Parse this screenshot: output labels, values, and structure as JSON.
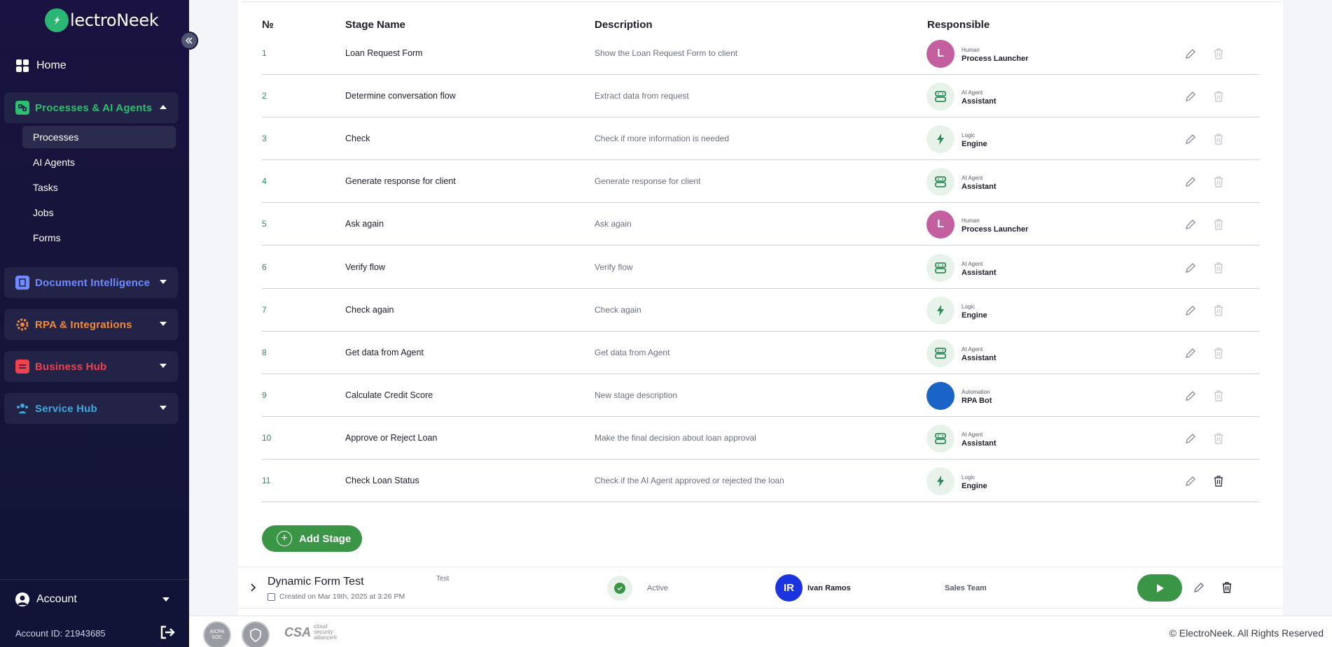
{
  "sidebar": {
    "logo_text": "lectroNeek",
    "home_label": "Home",
    "groups": [
      {
        "label": "Processes & AI Agents",
        "color": "#2bbf6f",
        "expanded": true
      },
      {
        "label": "Document Intelligence",
        "color": "#6e8cff",
        "expanded": false
      },
      {
        "label": "RPA & Integrations",
        "color": "#f08a3c",
        "expanded": false
      },
      {
        "label": "Business Hub",
        "color": "#f0414f",
        "expanded": false
      },
      {
        "label": "Service Hub",
        "color": "#40a8dc",
        "expanded": false
      }
    ],
    "subitems": [
      "Processes",
      "AI Agents",
      "Tasks",
      "Jobs",
      "Forms"
    ],
    "active_subitem": "Processes",
    "account_label": "Account",
    "account_id": "Account ID: 21943685"
  },
  "table": {
    "headers": {
      "num": "№",
      "name": "Stage Name",
      "desc": "Description",
      "resp": "Responsible"
    },
    "rows": [
      {
        "num": "1",
        "name": "Loan Request Form",
        "desc": "Show the Loan Request Form to client",
        "kind": "human",
        "avatar": "L",
        "rtype": "Human",
        "rname": "Process Launcher"
      },
      {
        "num": "2",
        "name": "Determine conversation flow",
        "desc": "Extract data from request",
        "kind": "ai",
        "avatar": "",
        "rtype": "AI Agent",
        "rname": "Assistant"
      },
      {
        "num": "3",
        "name": "Check",
        "desc": "Check if more information is needed",
        "kind": "logic",
        "avatar": "",
        "rtype": "Logic",
        "rname": "Engine"
      },
      {
        "num": "4",
        "name": "Generate response for client",
        "desc": "Generate response for client",
        "kind": "ai",
        "avatar": "",
        "rtype": "AI Agent",
        "rname": "Assistant"
      },
      {
        "num": "5",
        "name": "Ask again",
        "desc": "Ask again",
        "kind": "human",
        "avatar": "L",
        "rtype": "Human",
        "rname": "Process Launcher"
      },
      {
        "num": "6",
        "name": "Verify flow",
        "desc": "Verify flow",
        "kind": "ai",
        "avatar": "",
        "rtype": "AI Agent",
        "rname": "Assistant"
      },
      {
        "num": "7",
        "name": "Check again",
        "desc": "Check again",
        "kind": "logic",
        "avatar": "",
        "rtype": "Logic",
        "rname": "Engine"
      },
      {
        "num": "8",
        "name": "Get data from Agent",
        "desc": "Get data from Agent",
        "kind": "ai",
        "avatar": "",
        "rtype": "AI Agent",
        "rname": "Assistant"
      },
      {
        "num": "9",
        "name": "Calculate Credit Score",
        "desc": "New stage description",
        "kind": "auto",
        "avatar": "",
        "rtype": "Automation",
        "rname": "RPA Bot"
      },
      {
        "num": "10",
        "name": "Approve or Reject Loan",
        "desc": "Make the final decision about loan approval",
        "kind": "ai",
        "avatar": "",
        "rtype": "AI Agent",
        "rname": "Assistant"
      },
      {
        "num": "11",
        "name": "Check Loan Status",
        "desc": "Check if the AI Agent approved or rejected the loan",
        "kind": "logic",
        "avatar": "",
        "rtype": "Logic",
        "rname": "Engine"
      }
    ],
    "add_stage_label": "Add Stage"
  },
  "process": {
    "title": "Dynamic Form Test",
    "created": "Created on Mar 19th, 2025 at 3:26 PM",
    "tag": "Test",
    "status": "Active",
    "owner_initials": "IR",
    "owner_name": "Ivan Ramos",
    "team": "Sales Team"
  },
  "footer": {
    "badge1": "AICPA SOC",
    "csa_big": "CSA",
    "csa_small": "cloud security alliance®",
    "copyright": "© ElectroNeek. All Rights Reserved"
  }
}
